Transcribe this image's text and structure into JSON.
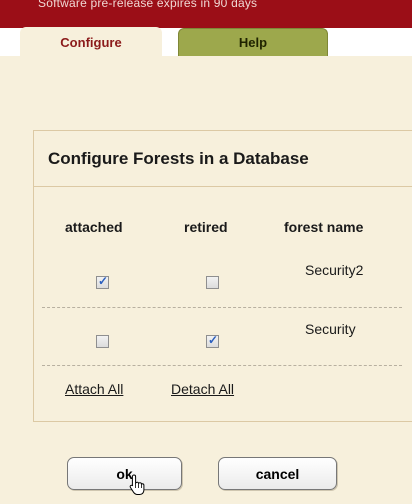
{
  "notice": "Software pre-release expires in 90 days",
  "tabs": {
    "configure": "Configure",
    "help": "Help"
  },
  "group": {
    "title": "Configure Forests in a Database"
  },
  "table": {
    "columns": [
      "attached",
      "retired",
      "forest name"
    ],
    "rows": [
      {
        "attached": true,
        "retired": false,
        "forest_name": "Security2"
      },
      {
        "attached": false,
        "retired": true,
        "forest_name": "Security"
      }
    ]
  },
  "links": {
    "attach_all": "Attach All",
    "detach_all": "Detach All"
  },
  "buttons": {
    "ok": "ok",
    "cancel": "cancel"
  },
  "colors": {
    "top_bar": "#9b0e17",
    "panel_bg": "#f7f0dc",
    "help_tab": "#9da84c",
    "active_tab_text": "#8b1a1a",
    "checkmark": "#2b5fbf"
  },
  "icons": {
    "cursor": "hand-pointer-icon"
  }
}
